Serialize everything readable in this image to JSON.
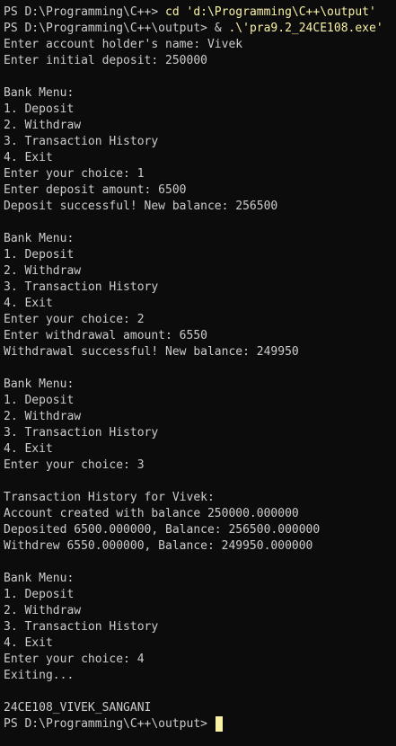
{
  "colors": {
    "background": "#0c0c0c",
    "foreground": "#cccccc",
    "command": "#f9f1a5",
    "cursor": "#f9f1a5"
  },
  "terminal": {
    "cmd1": {
      "prompt": "PS D:\\Programming\\C++> ",
      "command": "cd",
      "argument": " 'd:\\Programming\\C++\\output'"
    },
    "cmd2": {
      "prompt": "PS D:\\Programming\\C++\\output> ",
      "operator": "& ",
      "argument": ".\\'pra9.2_24CE108.exe'"
    },
    "output_lines": [
      "Enter account holder's name: Vivek",
      "Enter initial deposit: 250000",
      "",
      "Bank Menu:",
      "1. Deposit",
      "2. Withdraw",
      "3. Transaction History",
      "4. Exit",
      "Enter your choice: 1",
      "Enter deposit amount: 6500",
      "Deposit successful! New balance: 256500",
      "",
      "Bank Menu:",
      "1. Deposit",
      "2. Withdraw",
      "3. Transaction History",
      "4. Exit",
      "Enter your choice: 2",
      "Enter withdrawal amount: 6550",
      "Withdrawal successful! New balance: 249950",
      "",
      "Bank Menu:",
      "1. Deposit",
      "2. Withdraw",
      "3. Transaction History",
      "4. Exit",
      "Enter your choice: 3",
      "",
      "Transaction History for Vivek:",
      "Account created with balance 250000.000000",
      "Deposited 6500.000000, Balance: 256500.000000",
      "Withdrew 6550.000000, Balance: 249950.000000",
      "",
      "Bank Menu:",
      "1. Deposit",
      "2. Withdraw",
      "3. Transaction History",
      "4. Exit",
      "Enter your choice: 4",
      "Exiting...",
      "",
      "24CE108_VIVEK_SANGANI"
    ],
    "final_prompt": "PS D:\\Programming\\C++\\output> "
  }
}
